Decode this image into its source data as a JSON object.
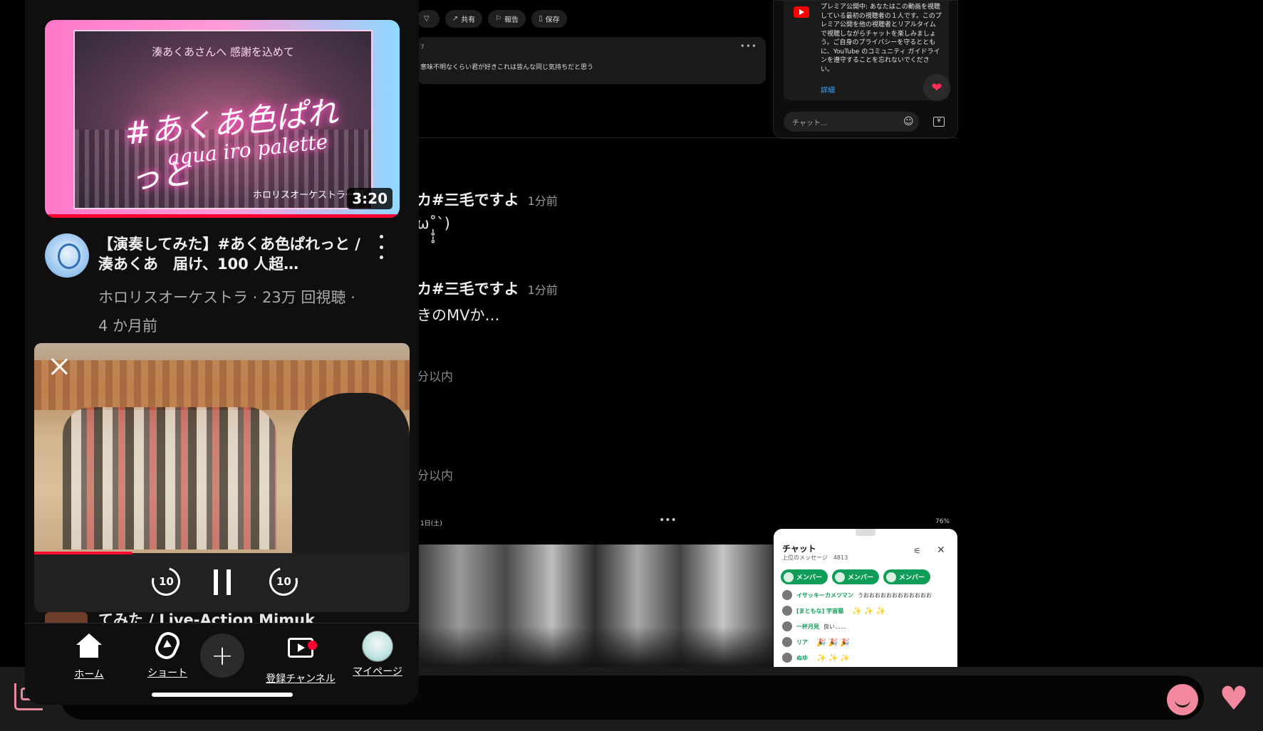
{
  "background": {
    "actions": [
      {
        "icon": "dislike-icon",
        "label": ""
      },
      {
        "icon": "share-icon",
        "label": "共有"
      },
      {
        "icon": "flag-icon",
        "label": "報告"
      },
      {
        "icon": "bookmark-icon",
        "label": "保存"
      }
    ],
    "comment": {
      "number": "7",
      "text": "意味不明なくらい君が好きこれは皆んな同じ気持ちだと思う",
      "dots": "•••"
    },
    "premiere_notice": {
      "text": "プレミア公開中: あなたはこの動画を視聴している最初の視聴者の１人です。このプレミア公開を他の視聴者とリアルタイムで視聴しながらチャットを楽しみましょう。ご自身のプライバシーを守るとともに、YouTube のコミュニティ ガイドラインを遵守することを忘れないでください。",
      "link": "詳細",
      "heart": "❤",
      "chat_placeholder": "チャット...",
      "emoji": "☺",
      "yen": "¥"
    },
    "messages": [
      {
        "name": "カ#三毛ですよ",
        "time": "1分前",
        "body": "ω˚̩̥̩̥`)"
      },
      {
        "name": "カ#三毛ですよ",
        "time": "1分前",
        "body": "きのMVか…"
      }
    ],
    "faint": [
      "分以内",
      "分以内"
    ],
    "tablet": {
      "left": "1日(土)",
      "mid": "•••",
      "right": "76%"
    },
    "chat_panel": {
      "title": "チャット",
      "subtitle": "上位のメッセージ",
      "count": "4813",
      "filter": "⚟",
      "close": "✕",
      "chips": [
        "メンバー",
        "メンバー",
        "メンバー"
      ],
      "lines": [
        {
          "name": "イサッキーカメツマン",
          "text": "うおおおおおおおおおおおお",
          "emoji": ""
        },
        {
          "name": "[まともな] 宇宙猫",
          "text": "",
          "emoji": "✨✨✨"
        },
        {
          "name": "一杯月見",
          "text": "良い……",
          "emoji": ""
        },
        {
          "name": "リア",
          "text": "",
          "emoji": "🎉🎉🎉"
        },
        {
          "name": "ぬゆ",
          "text": "",
          "emoji": "✨✨✨"
        }
      ]
    }
  },
  "phone": {
    "thumbnail": {
      "caption": "湊あくあさんへ 感謝を込めて",
      "hashtag": "#あくあ色ぱれっと",
      "subtitle": "aqua iro palette",
      "credit": "ホロリスオーケストラ一同",
      "duration": "3:20"
    },
    "video_title": "【演奏してみた】#あくあ色ぱれっと / 湊あくあ　届け、100 人超…",
    "video_meta": "ホロリスオーケストラ · 23万 回視聴 · 4 か月前",
    "mini_player": {
      "progress": 0.26,
      "rewind_label": "10",
      "forward_label": "10"
    },
    "next_title_peek": "てみた / Live-Action Mimuk",
    "nav": [
      {
        "icon": "home-icon",
        "label": "ホーム"
      },
      {
        "icon": "shorts-icon",
        "label": "ショート"
      },
      {
        "icon": "create-icon",
        "label": "+"
      },
      {
        "icon": "subscriptions-icon",
        "label": "登録チャンネル"
      },
      {
        "icon": "profile-avatar",
        "label": "マイページ"
      }
    ]
  },
  "colors": {
    "accent_red": "#ff0033",
    "pink": "#f2889e",
    "chip_green": "#0f9d58",
    "link_blue": "#3ea6ff"
  }
}
